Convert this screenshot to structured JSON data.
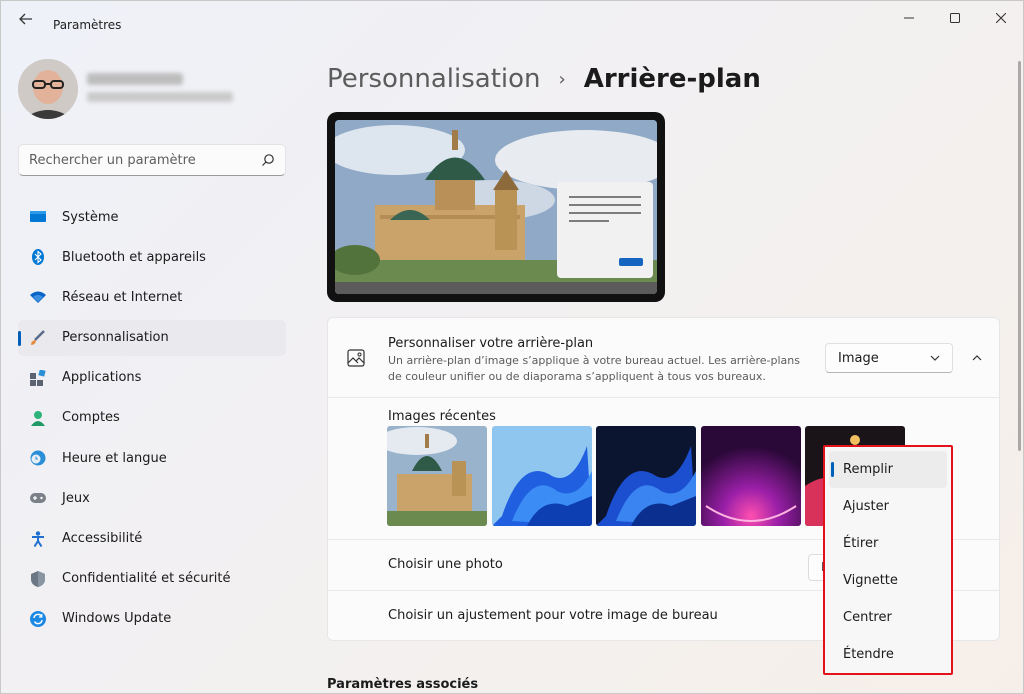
{
  "window": {
    "title": "Paramètres",
    "back_icon": "arrow-left-icon",
    "controls": [
      "minimize",
      "maximize",
      "close"
    ]
  },
  "search": {
    "placeholder": "Rechercher un paramètre",
    "icon": "search-icon"
  },
  "sidebar": {
    "items": [
      {
        "label": "Système",
        "icon": "system-icon",
        "color": "#0078d4",
        "active": false
      },
      {
        "label": "Bluetooth et appareils",
        "icon": "bluetooth-icon",
        "color": "#0078d4",
        "active": false
      },
      {
        "label": "Réseau et Internet",
        "icon": "wifi-icon",
        "color": "#0a64c8",
        "active": false
      },
      {
        "label": "Personnalisation",
        "icon": "brush-icon",
        "color": "#e88a3a",
        "active": true
      },
      {
        "label": "Applications",
        "icon": "apps-icon",
        "color": "#5b6470",
        "active": false
      },
      {
        "label": "Comptes",
        "icon": "account-icon",
        "color": "#2db37a",
        "active": false
      },
      {
        "label": "Heure et langue",
        "icon": "clock-globe-icon",
        "color": "#2a8fd6",
        "active": false
      },
      {
        "label": "Jeux",
        "icon": "gamepad-icon",
        "color": "#7a7f88",
        "active": false
      },
      {
        "label": "Accessibilité",
        "icon": "accessibility-icon",
        "color": "#1f6fd0",
        "active": false
      },
      {
        "label": "Confidentialité et sécurité",
        "icon": "shield-icon",
        "color": "#6b7785",
        "active": false
      },
      {
        "label": "Windows Update",
        "icon": "update-icon",
        "color": "#1e88e5",
        "active": false
      }
    ]
  },
  "breadcrumb": {
    "parent": "Personnalisation",
    "separator": "›",
    "current": "Arrière-plan"
  },
  "background_panel": {
    "title": "Personnaliser votre arrière-plan",
    "description": "Un arrière-plan d’image s’applique à votre bureau actuel. Les arrière-plans de couleur unifier ou de diaporama s’appliquent à tous vos bureaux.",
    "type_select": "Image",
    "recent_images_label": "Images récentes",
    "choose_photo_label": "Choisir une photo",
    "choose_photo_button_stub": "P",
    "fit_label": "Choisir un ajustement pour votre image de bureau"
  },
  "fit_dropdown": {
    "options": [
      "Remplir",
      "Ajuster",
      "Étirer",
      "Vignette",
      "Centrer",
      "Étendre"
    ],
    "selected": "Remplir",
    "highlight_color": "#e2111a"
  },
  "related": {
    "title": "Paramètres associés"
  },
  "colors": {
    "accent": "#005fb8"
  }
}
